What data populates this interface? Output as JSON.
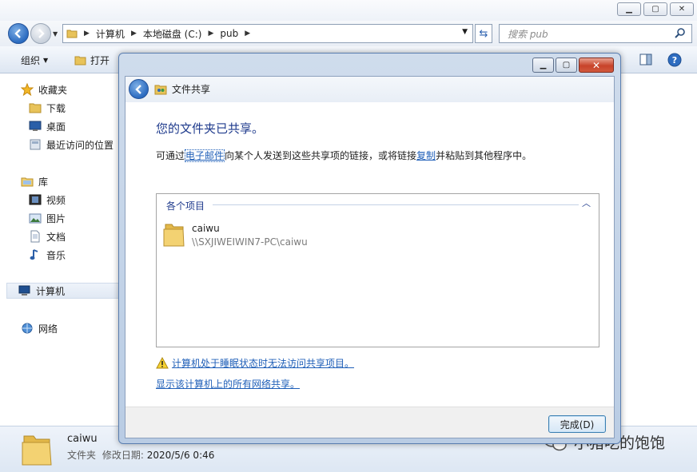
{
  "explorer": {
    "breadcrumb": [
      "计算机",
      "本地磁盘 (C:)",
      "pub"
    ],
    "search_placeholder": "搜索 pub",
    "toolbar": {
      "organize": "组织",
      "open": "打开"
    },
    "sidebar": {
      "favorites": "收藏夹",
      "downloads": "下载",
      "desktop": "桌面",
      "recent": "最近访问的位置",
      "libraries": "库",
      "videos": "视频",
      "pictures": "图片",
      "documents": "文档",
      "music": "音乐",
      "computer": "计算机",
      "network": "网络"
    },
    "details": {
      "name": "caiwu",
      "type": "文件夹",
      "modified_label": "修改日期:",
      "modified_value": "2020/5/6 0:46"
    }
  },
  "dialog": {
    "title": "文件共享",
    "heading": "您的文件夹已共享。",
    "desc_prefix": "可通过",
    "desc_email_link": "电子邮件",
    "desc_middle": "向某个人发送到这些共享项的链接，或将链接",
    "desc_copy_link": "复制",
    "desc_suffix": "并粘贴到其他程序中。",
    "group_header": "各个项目",
    "items": [
      {
        "name": "caiwu",
        "path": "\\\\SXJIWEIWIN7-PC\\caiwu"
      }
    ],
    "warning_link": "计算机处于睡眠状态时无法访问共享项目。",
    "show_all_link": "显示该计算机上的所有网络共享。",
    "done_button": "完成(D)"
  },
  "watermark": "小猪吃的饱饱",
  "colors": {
    "accent": "#1f5fb8",
    "heading": "#1e3a8c"
  }
}
